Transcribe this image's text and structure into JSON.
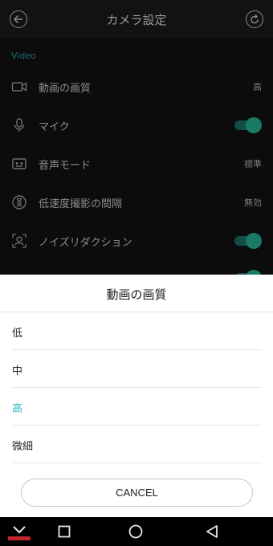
{
  "header": {
    "title": "カメラ設定",
    "back_icon": "back-arrow-icon",
    "reset_icon": "reset-icon"
  },
  "settings": {
    "section_label": "Video",
    "rows": [
      {
        "icon": "video-icon",
        "label": "動画の画質",
        "value": "高"
      },
      {
        "icon": "microphone-icon",
        "label": "マイク",
        "toggle": true
      },
      {
        "icon": "audio-mode-icon",
        "label": "音声モード",
        "value": "標準"
      },
      {
        "icon": "hourglass-icon",
        "label": "低速度撮影の間隔",
        "value": "無効"
      },
      {
        "icon": "noise-reduction-icon",
        "label": "ノイズリダクション",
        "toggle": true
      }
    ]
  },
  "sheet": {
    "title": "動画の画質",
    "options": [
      "低",
      "中",
      "高",
      "微細"
    ],
    "selected_index": 2,
    "cancel_label": "CANCEL"
  },
  "colors": {
    "accent": "#35b6c4",
    "section": "#1f6b6a",
    "toggle_on": "#1a7a66"
  },
  "navbar": {
    "items": [
      "chevron-down-icon",
      "recents-icon",
      "home-icon",
      "back-icon"
    ]
  }
}
